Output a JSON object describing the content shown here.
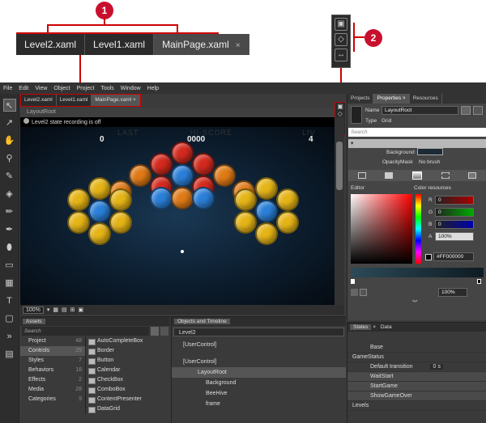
{
  "callout": {
    "badge1": "1",
    "badge2": "2",
    "tabs": [
      "Level2.xaml",
      "Level1.xaml",
      "MainPage.xaml"
    ],
    "tab_close": "×"
  },
  "menu": [
    "File",
    "Edit",
    "View",
    "Object",
    "Project",
    "Tools",
    "Window",
    "Help"
  ],
  "doc_tabs": [
    "Level2.xaml",
    "Level1.xaml",
    "MainPage.xaml"
  ],
  "doc_tab_close": "×",
  "breadcrumb": "LayoutRoot",
  "artboard": {
    "recording_status": "Level2 state recording is off",
    "score_left": "0",
    "score_center": "0000",
    "score_right": "4",
    "banner_left": "LAST",
    "banner_center": "HI-SCORE",
    "banner_right": "LIV"
  },
  "zoom": {
    "level": "100%"
  },
  "properties_panel": {
    "tabs": [
      "Projects",
      "Properties",
      "Resources"
    ],
    "tab_close": "×",
    "name_label": "Name",
    "name_value": "LayoutRoot",
    "type_label": "Type",
    "type_value": "Grid",
    "search_placeholder": "Search",
    "background_label": "Background",
    "opacitymask_label": "OpacityMask",
    "opacitymask_value": "No brush",
    "editor_label": "Editor",
    "color_resources_label": "Color resources",
    "r_label": "R",
    "r_value": "0",
    "g_label": "G",
    "g_value": "0",
    "b_label": "B",
    "b_value": "0",
    "a_label": "A",
    "a_value": "100%",
    "hex_value": "#FF000000",
    "opacity_value": "100%"
  },
  "assets": {
    "title": "Assets",
    "search_placeholder": "Search",
    "categories": [
      {
        "label": "Project",
        "count": "48"
      },
      {
        "label": "Controls",
        "count": "25"
      },
      {
        "label": "Styles",
        "count": "7"
      },
      {
        "label": "Behaviors",
        "count": "18"
      },
      {
        "label": "Effects",
        "count": "2"
      },
      {
        "label": "Media",
        "count": "28"
      },
      {
        "label": "Categories",
        "count": "9"
      }
    ],
    "items": [
      "AutoCompleteBox",
      "Border",
      "Button",
      "Calendar",
      "CheckBox",
      "ComboBox",
      "ContentPresenter",
      "DataGrid"
    ]
  },
  "objects": {
    "title": "Objects and Timeline",
    "state_combo": "Level2",
    "tree": [
      "[UserControl]",
      "[UserControl]",
      "LayoutRoot",
      "Background",
      "BeeHive",
      "frame"
    ]
  },
  "states": {
    "tabs": [
      "States",
      "Data"
    ],
    "tab_close": "×",
    "base": "Base",
    "group": "GameStatus",
    "default_transition": "Default transition",
    "transition_value": "0 s",
    "items": [
      "WaitStart",
      "StartGame",
      "ShowGameOver"
    ],
    "levels": "Levels"
  },
  "colors": {
    "accent": "#c8102e",
    "app_bg": "#3b3b3b"
  }
}
